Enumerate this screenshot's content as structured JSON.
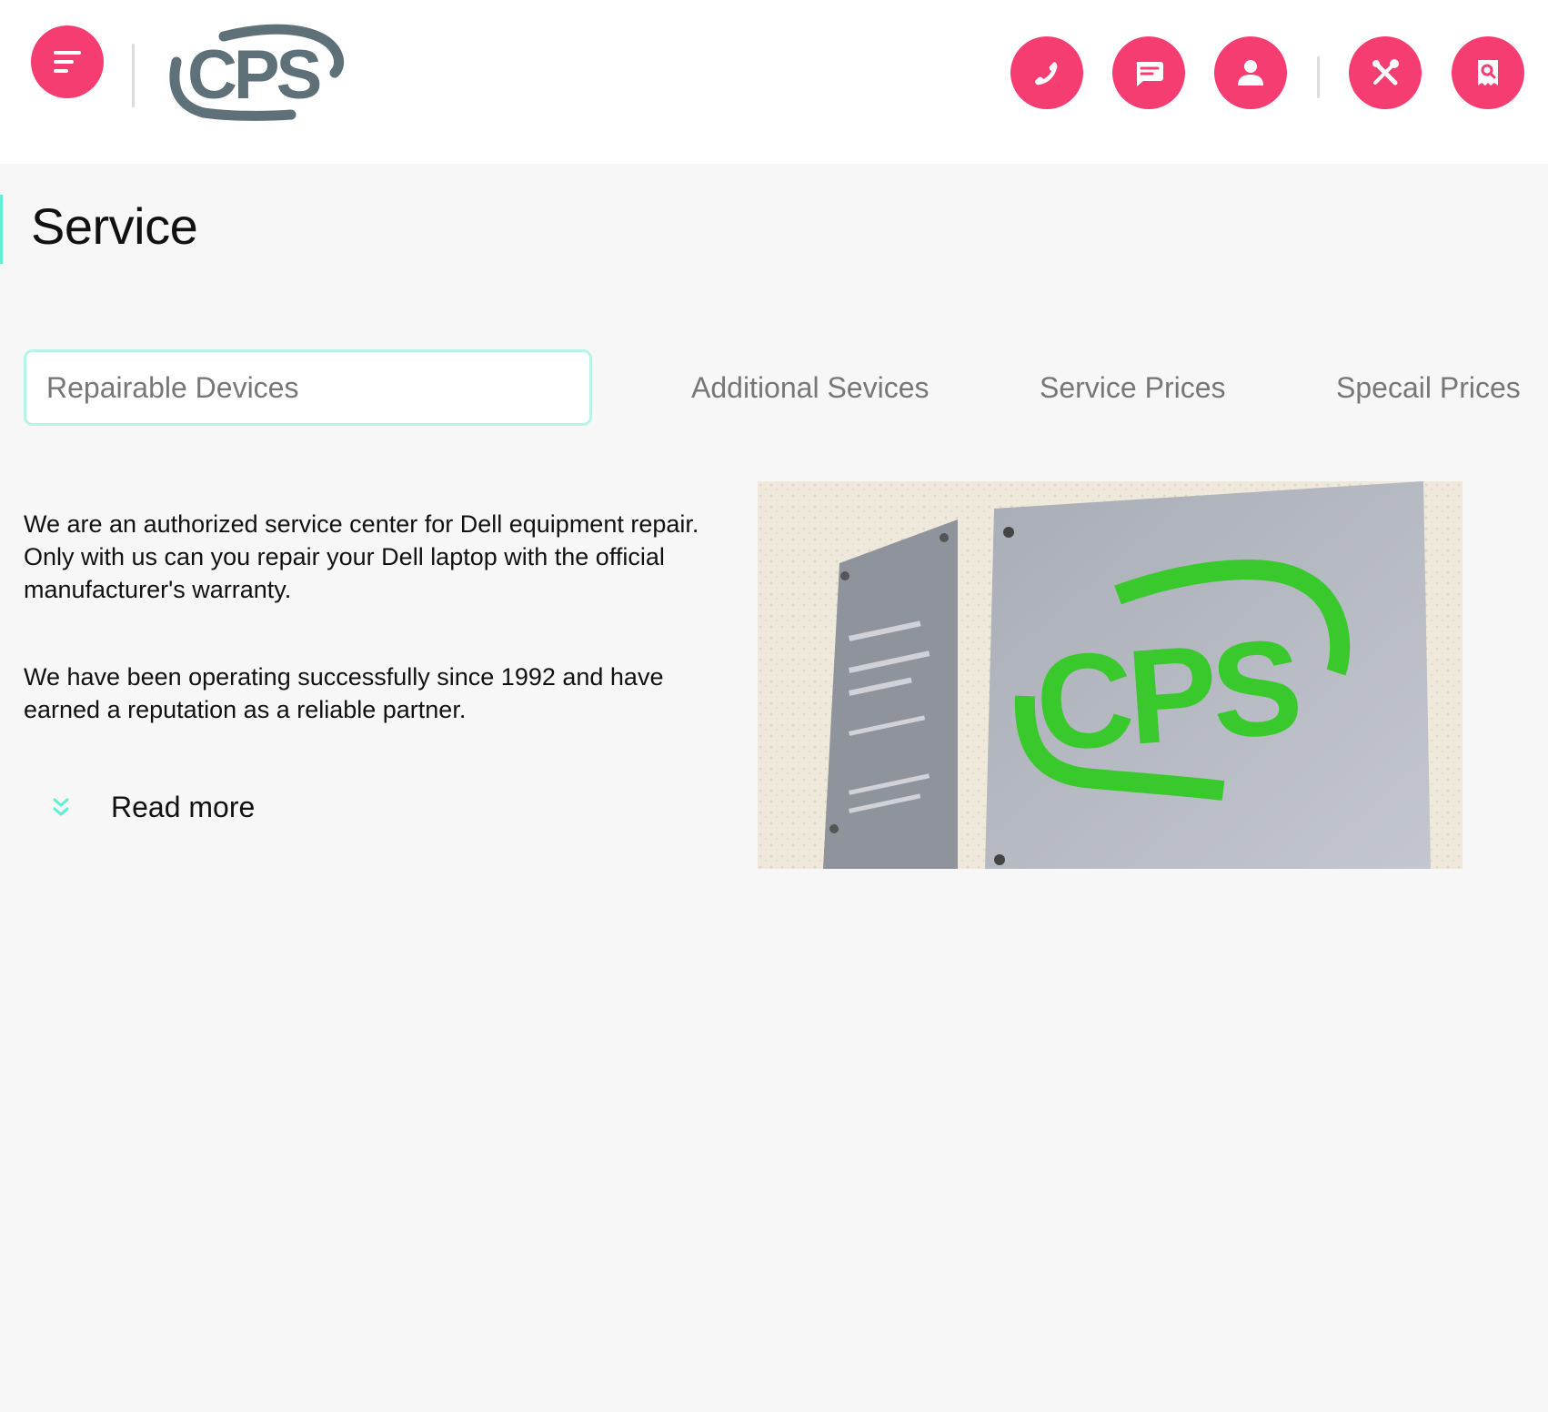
{
  "header": {
    "logo_text": "CPS",
    "menu_icon": "menu-icon",
    "actions": [
      {
        "name": "phone",
        "icon": "phone-icon"
      },
      {
        "name": "chat",
        "icon": "chat-icon"
      },
      {
        "name": "account",
        "icon": "user-icon"
      },
      {
        "name": "repair",
        "icon": "tools-icon"
      },
      {
        "name": "receipt",
        "icon": "receipt-search-icon"
      }
    ]
  },
  "page": {
    "title": "Service"
  },
  "tabs": [
    {
      "label": "Repairable Devices",
      "active": true
    },
    {
      "label": "Additional Sevices",
      "active": false
    },
    {
      "label": "Service Prices",
      "active": false
    },
    {
      "label": "Specail Prices",
      "active": false
    }
  ],
  "content": {
    "paragraph1": "We are an authorized service center for Dell equipment repair. Only with us can you repair your Dell laptop with the official manufacturer's warranty.",
    "paragraph2": "We have been operating successfully since 1992 and have earned a reputation as a reliable partner.",
    "read_more": "Read more",
    "photo_sign_text": "CPS"
  },
  "colors": {
    "accent_pink": "#f53d72",
    "accent_mint": "#5ef0d3",
    "logo_gray": "#5e7078",
    "sign_green": "#39c92d",
    "background": "#f7f7f7"
  }
}
